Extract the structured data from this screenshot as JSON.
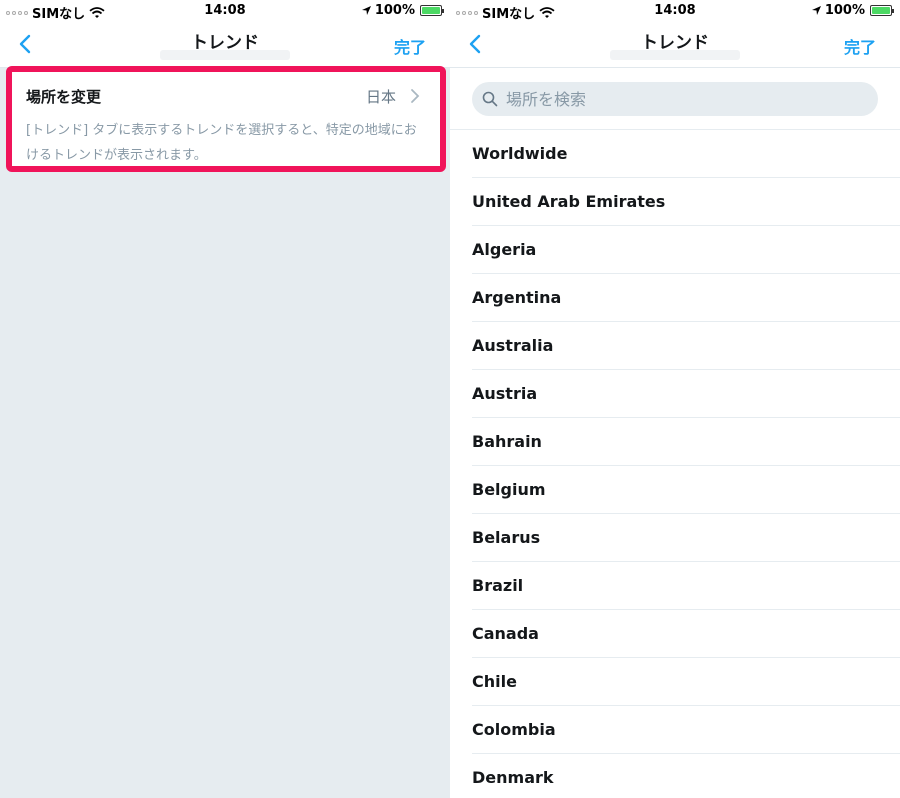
{
  "status_bar": {
    "carrier": "SIMなし",
    "time": "14:08",
    "battery": "100%",
    "battery_level": 1.0
  },
  "left_screen": {
    "nav": {
      "title": "トレンド",
      "done_label": "完了"
    },
    "location_row": {
      "label": "場所を変更",
      "value": "日本"
    },
    "description": "[トレンド] タブに表示するトレンドを選択すると、特定の地域におけるトレンドが表示されます。"
  },
  "right_screen": {
    "nav": {
      "title": "トレンド",
      "done_label": "完了"
    },
    "search": {
      "placeholder": "場所を検索",
      "value": ""
    },
    "countries": [
      "Worldwide",
      "United Arab Emirates",
      "Algeria",
      "Argentina",
      "Australia",
      "Austria",
      "Bahrain",
      "Belgium",
      "Belarus",
      "Brazil",
      "Canada",
      "Chile",
      "Colombia",
      "Denmark"
    ]
  },
  "colors": {
    "accent": "#1da1f2",
    "highlight": "#f0145a",
    "background": "#e6ecf0"
  }
}
